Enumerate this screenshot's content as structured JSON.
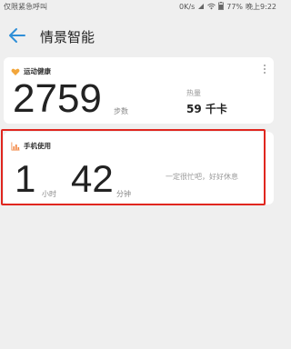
{
  "status_bar": {
    "carrier": "仅限紧急呼叫",
    "speed": "0K/s",
    "battery": "77%",
    "time": "晚上9:22"
  },
  "header": {
    "title": "情景智能"
  },
  "health_card": {
    "title": "运动健康",
    "steps": "2759",
    "steps_unit": "步数",
    "calorie_label": "热量",
    "calorie_value": "59 千卡"
  },
  "phone_card": {
    "title": "手机使用",
    "hours": "1",
    "hours_unit": "小时",
    "minutes": "42",
    "minutes_unit": "分钟",
    "message": "一定很忙吧，好好休息"
  },
  "colors": {
    "accent": "#2f8fd8",
    "highlight": "#e0261f",
    "health_icon": "#f2a63b",
    "phone_icon": "#f2813b"
  }
}
